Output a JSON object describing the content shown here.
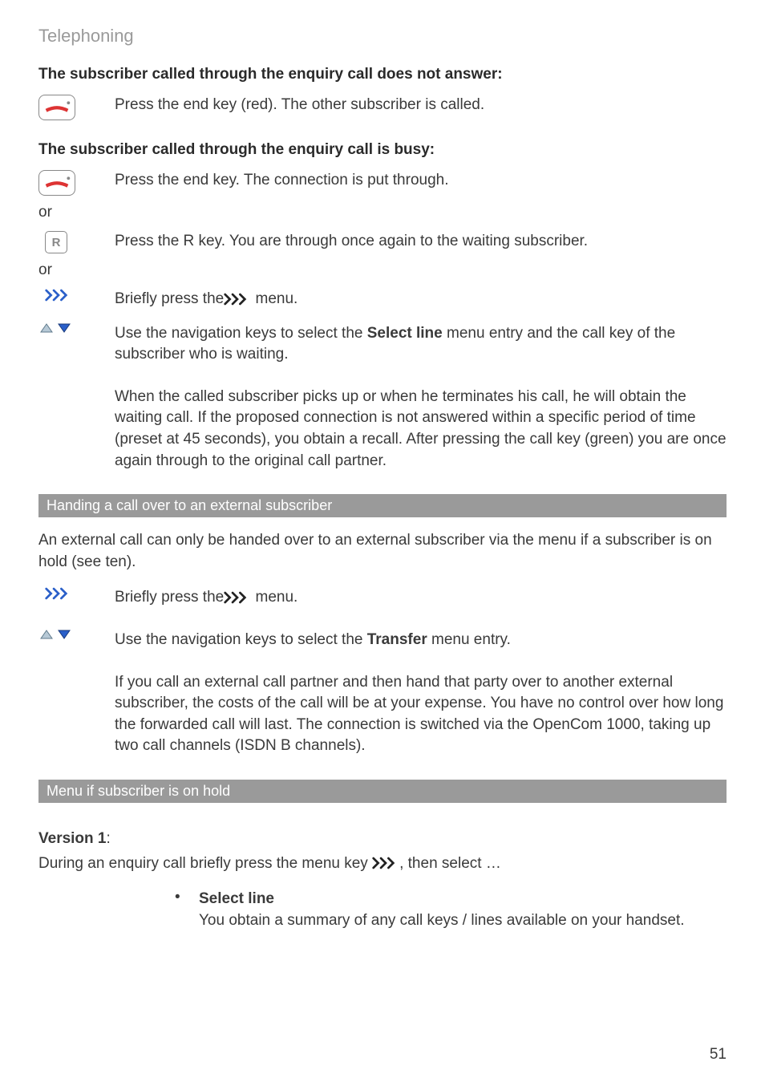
{
  "pageTitle": "Telephoning",
  "h1": "The subscriber called through the enquiry call does not answer:",
  "r1": "Press the end key (red). The other subscriber is called.",
  "h2": "The subscriber called through the enquiry call is busy:",
  "r2": "Press the end key. The connection is put through.",
  "or": "or",
  "r3": "Press the R key. You are through once again to the waiting subscriber.",
  "r4_pre": "Briefly press the",
  "r4_post": " menu.",
  "r5_pre": "Use the navigation keys to select the ",
  "r5_bold": "Select line",
  "r5_post": " menu entry and the call key of the subscriber who is waiting.",
  "r6": "When the called subscriber picks up or when he terminates his call, he will obtain the waiting call. If the proposed connection is not answered within a specific period of time (preset at 45 seconds), you obtain a recall. After pressing the call key (green) you are once again through to the original call partner.",
  "bar1": "Handing a call over to an external subscriber",
  "p1": "An external call can only be handed over to an external subscriber via the menu if a subscriber is on hold (see ten).",
  "r7_pre": "Briefly press the",
  "r7_post": " menu.",
  "r8_pre": "Use the navigation keys to select the ",
  "r8_bold": "Transfer",
  "r8_post": " menu entry.",
  "r9": "If you call an external call partner and then hand that party over to another external subscriber, the costs of the call will be at your expense. You have no control over how long the forwarded call will last. The connection is switched via the OpenCom 1000, taking up two call channels (ISDN B channels).",
  "bar2": "Menu if subscriber is on hold",
  "v1_pre": "Version ",
  "v1_num": "1",
  "v1_post": ":",
  "p2_pre": "During an enquiry call briefly press the menu key ",
  "p2_post": ", then select …",
  "bullet_dot": "•",
  "bullet_title": "Select line",
  "bullet_body": "You obtain a summary of any call keys / lines available on your handset.",
  "pageNum": "51",
  "rKeyLabel": "R"
}
